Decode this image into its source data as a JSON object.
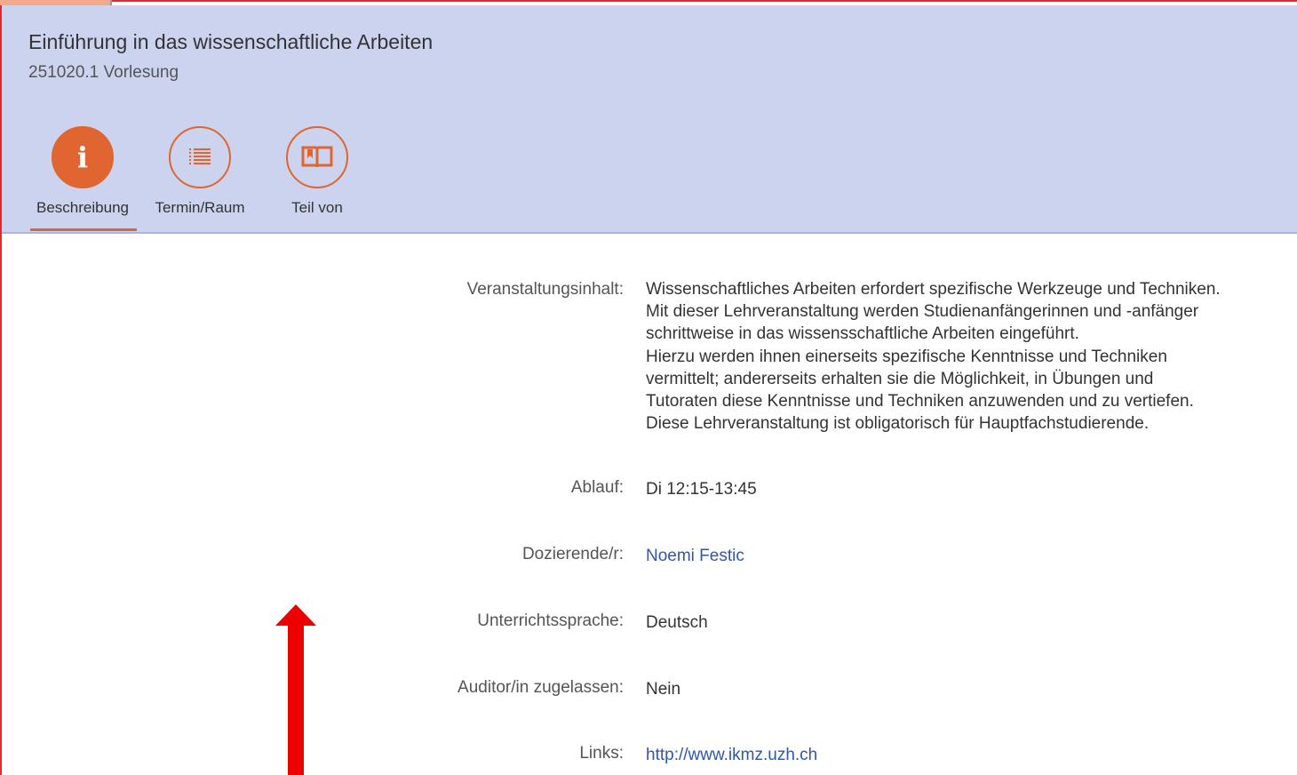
{
  "course": {
    "title": "Einführung in das wissenschaftliche Arbeiten",
    "subtitle": "251020.1 Vorlesung"
  },
  "tabs": [
    {
      "label": "Beschreibung",
      "icon": "info-icon",
      "active": true
    },
    {
      "label": "Termin/Raum",
      "icon": "list-icon",
      "active": false
    },
    {
      "label": "Teil von",
      "icon": "book-icon",
      "active": false
    }
  ],
  "details": {
    "content": {
      "label": "Veranstaltungsinhalt:",
      "lines": [
        "Wissenschaftliches Arbeiten erfordert spezifische Werkzeuge und Techniken.",
        "Mit dieser Lehrveranstaltung werden Studienanfängerinnen und -anfänger",
        "schrittweise in das wissensschaftliche Arbeiten eingeführt.",
        "Hierzu werden ihnen einerseits spezifische Kenntnisse und Techniken",
        "vermittelt; andererseits erhalten sie die Möglichkeit, in Übungen und",
        "Tutoraten diese Kenntnisse und Techniken anzuwenden und zu vertiefen.",
        "Diese Lehrveranstaltung ist obligatorisch für Hauptfachstudierende."
      ]
    },
    "schedule": {
      "label": "Ablauf:",
      "value": "Di 12:15-13:45"
    },
    "lecturer": {
      "label": "Dozierende/r:",
      "value": "Noemi Festic"
    },
    "language": {
      "label": "Unterrichtssprache:",
      "value": "Deutsch"
    },
    "auditor": {
      "label": "Auditor/in zugelassen:",
      "value": "Nein"
    },
    "links": {
      "label": "Links:",
      "value": "http://www.ikmz.uzh.ch"
    }
  },
  "colors": {
    "accent": "#e06530",
    "header_bg": "#cbd3ee",
    "link": "#3056b4",
    "annotation_arrow": "#ee0000",
    "annotation_border": "#e8262b"
  }
}
